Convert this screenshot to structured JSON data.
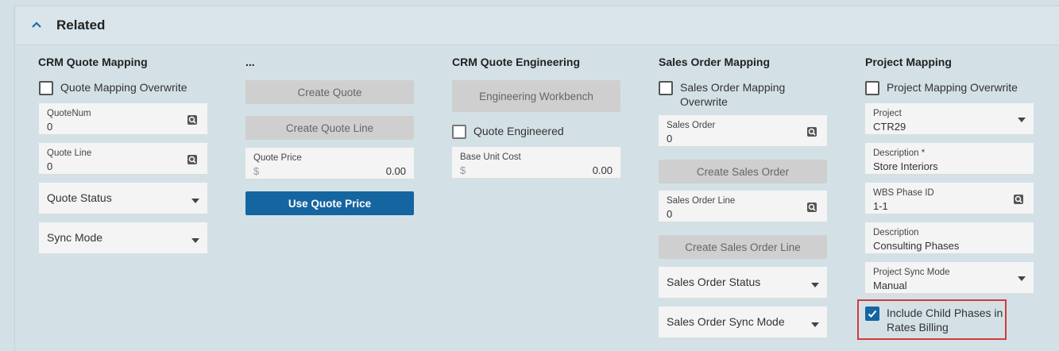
{
  "section": {
    "title": "Related",
    "toggle_icon": "chevron-up-icon"
  },
  "crm_quote_mapping": {
    "title": "CRM Quote Mapping",
    "overwrite_label": "Quote Mapping Overwrite",
    "quotenum_label": "QuoteNum",
    "quotenum_value": "0",
    "quoteline_label": "Quote Line",
    "quoteline_value": "0",
    "quote_status_label": "Quote Status",
    "sync_mode_label": "Sync Mode"
  },
  "misc": {
    "title": "...",
    "create_quote": "Create Quote",
    "create_quote_line": "Create Quote Line",
    "quote_price_label": "Quote Price",
    "currency": "$",
    "quote_price_value": "0.00",
    "use_quote_price": "Use Quote Price"
  },
  "crm_quote_engineering": {
    "title": "CRM Quote Engineering",
    "workbench": "Engineering Workbench",
    "engineered_label": "Quote Engineered",
    "base_cost_label": "Base Unit Cost",
    "currency": "$",
    "base_cost_value": "0.00"
  },
  "sales_order_mapping": {
    "title": "Sales Order Mapping",
    "overwrite_line1": "Sales Order Mapping",
    "overwrite_line2": "Overwrite",
    "so_label": "Sales Order",
    "so_value": "0",
    "create_so": "Create Sales Order",
    "so_line_label": "Sales Order Line",
    "so_line_value": "0",
    "create_so_line": "Create Sales Order Line",
    "so_status_label": "Sales Order Status",
    "so_sync_label": "Sales Order Sync Mode"
  },
  "project_mapping": {
    "title": "Project Mapping",
    "overwrite_label": "Project Mapping Overwrite",
    "project_label": "Project",
    "project_value": "CTR29",
    "desc_label": "Description *",
    "desc_value": "Store Interiors",
    "wbs_label": "WBS Phase ID",
    "wbs_value": "1-1",
    "desc2_label": "Description",
    "desc2_value": "Consulting Phases",
    "sync_label": "Project Sync Mode",
    "sync_value": "Manual",
    "include_line1": "Include Child Phases in",
    "include_line2": "Rates Billing",
    "include_checked": true
  },
  "colors": {
    "primary": "#1565a0",
    "highlight": "#d23b3b",
    "background": "#d3e1e6"
  }
}
